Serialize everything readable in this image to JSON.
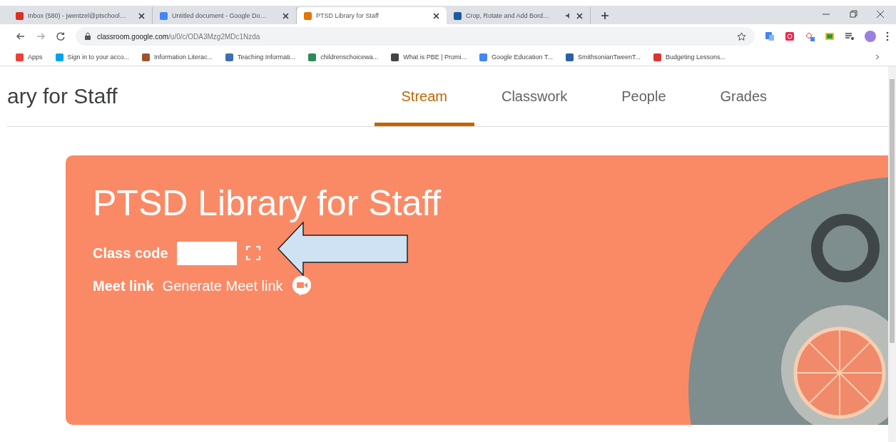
{
  "browser": {
    "tabs": [
      {
        "title": "Inbox (580) - jwentzel@ptschool…",
        "kind": "mail",
        "selected": false,
        "audio": false
      },
      {
        "title": "Untitled document - Google Do…",
        "kind": "doc",
        "selected": false,
        "audio": false
      },
      {
        "title": "PTSD Library for Staff",
        "kind": "classroom",
        "selected": true,
        "audio": false
      },
      {
        "title": "Crop, Rotate and Add Bord…",
        "kind": "page",
        "selected": false,
        "audio": true
      }
    ],
    "address": {
      "host": "classroom.google.com",
      "path": "/u/0/c/ODA3Mzg2MDc1Nzda"
    },
    "bookmarks": [
      {
        "label": "Apps",
        "kind": "apps"
      },
      {
        "label": "Sign in to your acco...",
        "kind": "ms"
      },
      {
        "label": "Information Literac...",
        "kind": "bottle"
      },
      {
        "label": "Teaching Informati...",
        "kind": "hat"
      },
      {
        "label": "childrenschoicewa...",
        "kind": "pin"
      },
      {
        "label": "What is PBE | Promi...",
        "kind": "globe"
      },
      {
        "label": "Google Education T...",
        "kind": "square"
      },
      {
        "label": "SmithsonianTweenT...",
        "kind": "pillar"
      },
      {
        "label": "Budgeting Lessons...",
        "kind": "flag"
      }
    ]
  },
  "header": {
    "title": "ary for Staff",
    "tabs": [
      {
        "label": "Stream",
        "selected": true
      },
      {
        "label": "Classwork",
        "selected": false
      },
      {
        "label": "People",
        "selected": false
      },
      {
        "label": "Grades",
        "selected": false
      }
    ]
  },
  "banner": {
    "title": "PTSD Library for Staff",
    "class_code_label": "Class code",
    "meet_label": "Meet link",
    "meet_action": "Generate Meet link"
  }
}
